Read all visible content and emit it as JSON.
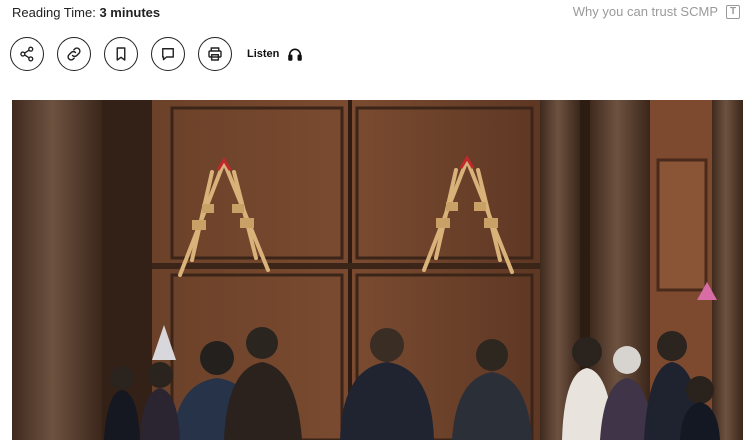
{
  "header": {
    "reading_label": "Reading Time: ",
    "reading_value": "3 minutes",
    "trust_link": "Why you can trust SCMP",
    "trust_icon_glyph": "T"
  },
  "actions": {
    "items": [
      {
        "name": "share-button",
        "icon": "share-icon"
      },
      {
        "name": "copy-link-button",
        "icon": "link-icon"
      },
      {
        "name": "bookmark-button",
        "icon": "bookmark-icon"
      },
      {
        "name": "comment-button",
        "icon": "comment-icon"
      },
      {
        "name": "print-button",
        "icon": "printer-icon"
      }
    ],
    "listen_label": "Listen",
    "listen_icon": "headphones-icon"
  },
  "photo": {
    "subject": "article-hero-photo"
  }
}
